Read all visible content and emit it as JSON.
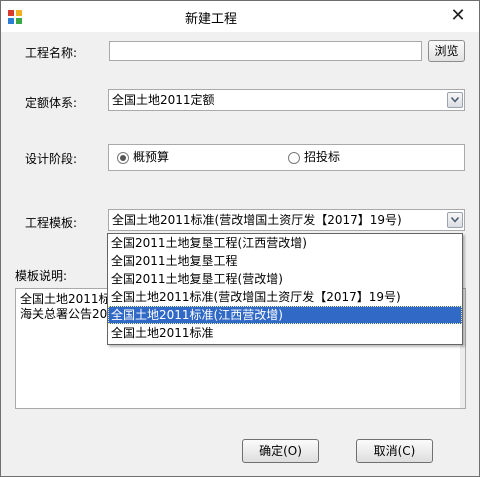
{
  "window": {
    "title": "新建工程",
    "close_glyph": "✕"
  },
  "form": {
    "project_name": {
      "label": "工程名称:",
      "value": "",
      "browse_label": "浏览"
    },
    "quota_system": {
      "label": "定额体系:",
      "value": "全国土地2011定额"
    },
    "design_stage": {
      "label": "设计阶段:",
      "options": [
        "概预算",
        "招投标"
      ],
      "selected": "概预算"
    },
    "template": {
      "label": "工程模板:",
      "value": "全国土地2011标准(营改增国土资厅发【2017】19号)"
    },
    "template_desc": {
      "label": "模板说明:",
      "line1": "全国土地2011标",
      "line2": "海关总署公告20"
    }
  },
  "template_options": [
    "全国2011土地复垦工程(江西营改增)",
    "全国2011土地复垦工程",
    "全国2011土地复垦工程(营改增)",
    "全国土地2011标准(营改增国土资厅发【2017】19号)",
    "全国土地2011标准(江西营改增)",
    "全国土地2011标准"
  ],
  "selected_template_option": "全国土地2011标准(江西营改增)",
  "buttons": {
    "ok": "确定(O)",
    "cancel": "取消(C)"
  },
  "icons": {
    "app": "app-icon",
    "close": "close-icon",
    "dropdown": "chevron-down-icon"
  }
}
